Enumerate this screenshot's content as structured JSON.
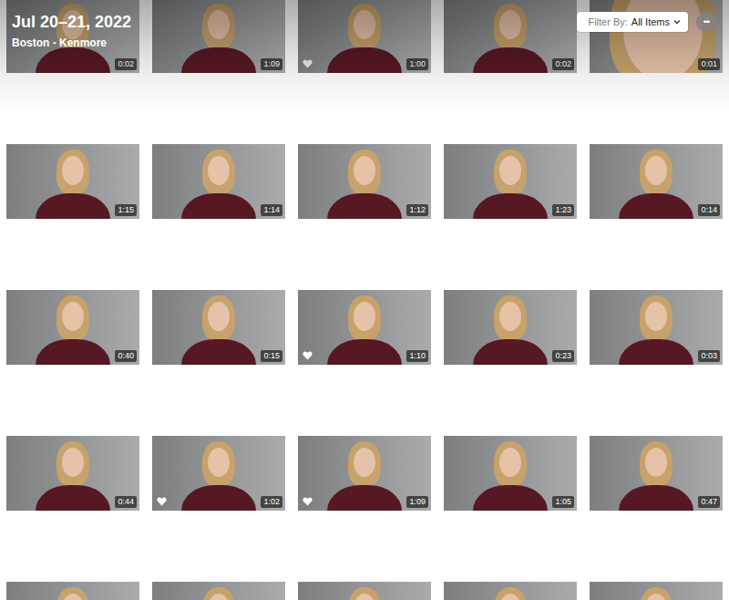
{
  "header": {
    "title": "Jul 20–21, 2022",
    "subtitle": "Boston - Kenmore"
  },
  "filter": {
    "label": "Filter By:",
    "value": "All Items"
  },
  "more": "•••",
  "rows": [
    [
      {
        "kind": "portrait",
        "duration": "0:02",
        "favorite": false
      },
      {
        "kind": "portrait",
        "duration": "1:09",
        "favorite": false
      },
      {
        "kind": "portrait",
        "duration": "1:00",
        "favorite": true
      },
      {
        "kind": "portrait",
        "duration": "0:02",
        "favorite": false
      },
      {
        "kind": "closeup",
        "duration": "0:01",
        "favorite": false
      }
    ],
    [
      {
        "kind": "portrait",
        "duration": "1:15",
        "favorite": false
      },
      {
        "kind": "portrait",
        "duration": "1:14",
        "favorite": false
      },
      {
        "kind": "portrait",
        "duration": "1:12",
        "favorite": false
      },
      {
        "kind": "portrait",
        "duration": "1:23",
        "favorite": false
      },
      {
        "kind": "portrait",
        "duration": "0:14",
        "favorite": false
      }
    ],
    [
      {
        "kind": "portrait",
        "duration": "0:40",
        "favorite": false
      },
      {
        "kind": "portrait",
        "duration": "0:15",
        "favorite": false
      },
      {
        "kind": "portrait",
        "duration": "1:10",
        "favorite": true
      },
      {
        "kind": "portrait",
        "duration": "0:23",
        "favorite": false
      },
      {
        "kind": "portrait",
        "duration": "0:03",
        "favorite": false
      }
    ],
    [
      {
        "kind": "portrait",
        "duration": "0:44",
        "favorite": false
      },
      {
        "kind": "portrait",
        "duration": "1:02",
        "favorite": true
      },
      {
        "kind": "portrait",
        "duration": "1:09",
        "favorite": true
      },
      {
        "kind": "portrait",
        "duration": "1:05",
        "favorite": false
      },
      {
        "kind": "portrait",
        "duration": "0:47",
        "favorite": false
      }
    ],
    [
      {
        "kind": "cut",
        "favorite": false
      },
      {
        "kind": "cut",
        "favorite": false
      },
      {
        "kind": "cut",
        "favorite": false
      },
      {
        "kind": "cut",
        "favorite": false
      },
      {
        "kind": "cut",
        "favorite": false
      }
    ]
  ]
}
